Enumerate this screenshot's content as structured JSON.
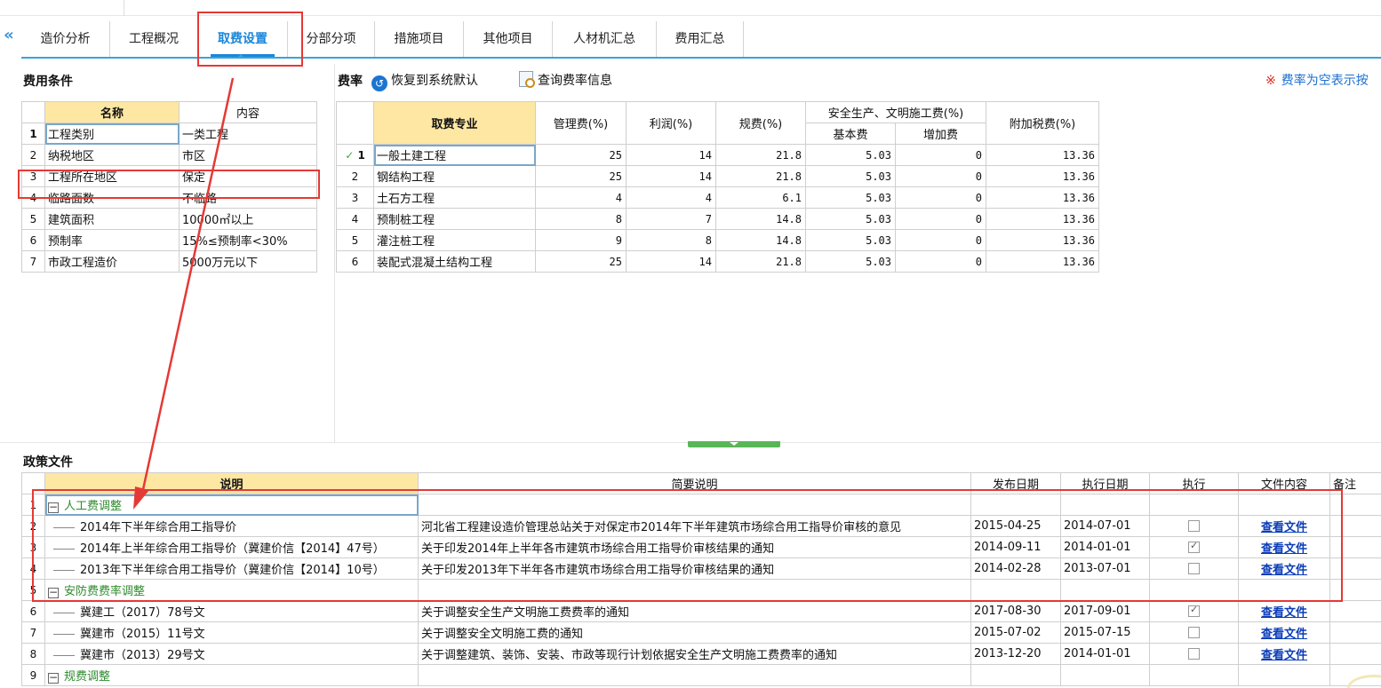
{
  "tabs": [
    {
      "label": "造价分析",
      "active": false
    },
    {
      "label": "工程概况",
      "active": false
    },
    {
      "label": "取费设置",
      "active": true
    },
    {
      "label": "分部分项",
      "active": false
    },
    {
      "label": "措施项目",
      "active": false
    },
    {
      "label": "其他项目",
      "active": false
    },
    {
      "label": "人材机汇总",
      "active": false
    },
    {
      "label": "费用汇总",
      "active": false
    }
  ],
  "conditions": {
    "title": "费用条件",
    "col_name": "名称",
    "col_content": "内容",
    "rows": [
      {
        "no": "1",
        "name": "工程类别",
        "value": "一类工程"
      },
      {
        "no": "2",
        "name": "纳税地区",
        "value": "市区"
      },
      {
        "no": "3",
        "name": "工程所在地区",
        "value": "保定"
      },
      {
        "no": "4",
        "name": "临路面数",
        "value": "不临路"
      },
      {
        "no": "5",
        "name": "建筑面积",
        "value": "10000㎡以上"
      },
      {
        "no": "6",
        "name": "预制率",
        "value": "15%≤预制率<30%"
      },
      {
        "no": "7",
        "name": "市政工程造价",
        "value": "5000万元以下"
      }
    ]
  },
  "rates": {
    "title": "费率",
    "restore_label": "恢复到系统默认",
    "query_label": "查询费率信息",
    "note_mark": "※",
    "note_text": "费率为空表示按",
    "headers": {
      "specialty": "取费专业",
      "mgmt": "管理费(%)",
      "profit": "利润(%)",
      "fee": "规费(%)",
      "safety_group": "安全生产、文明施工费(%)",
      "safety_base": "基本费",
      "safety_extra": "增加费",
      "tax": "附加税费(%)"
    },
    "check_mark": "✓",
    "rows": [
      {
        "no": "1",
        "name": "一般土建工程",
        "mgmt": "25",
        "profit": "14",
        "fee": "21.8",
        "base": "5.03",
        "extra": "0",
        "tax": "13.36"
      },
      {
        "no": "2",
        "name": "钢结构工程",
        "mgmt": "25",
        "profit": "14",
        "fee": "21.8",
        "base": "5.03",
        "extra": "0",
        "tax": "13.36"
      },
      {
        "no": "3",
        "name": "土石方工程",
        "mgmt": "4",
        "profit": "4",
        "fee": "6.1",
        "base": "5.03",
        "extra": "0",
        "tax": "13.36"
      },
      {
        "no": "4",
        "name": "预制桩工程",
        "mgmt": "8",
        "profit": "7",
        "fee": "14.8",
        "base": "5.03",
        "extra": "0",
        "tax": "13.36"
      },
      {
        "no": "5",
        "name": "灌注桩工程",
        "mgmt": "9",
        "profit": "8",
        "fee": "14.8",
        "base": "5.03",
        "extra": "0",
        "tax": "13.36"
      },
      {
        "no": "6",
        "name": "装配式混凝土结构工程",
        "mgmt": "25",
        "profit": "14",
        "fee": "21.8",
        "base": "5.03",
        "extra": "0",
        "tax": "13.36"
      }
    ]
  },
  "policy": {
    "title": "政策文件",
    "headers": {
      "desc": "说明",
      "summary": "简要说明",
      "pub": "发布日期",
      "exec": "执行日期",
      "run": "执行",
      "file": "文件内容",
      "remark": "备注"
    },
    "tree_toggle": "−",
    "link_label": "查看文件",
    "rows": [
      {
        "no": "1",
        "type": "group",
        "desc": "人工费调整"
      },
      {
        "no": "2",
        "type": "item",
        "desc": "2014年下半年综合用工指导价",
        "summary": "河北省工程建设造价管理总站关于对保定市2014年下半年建筑市场综合用工指导价审核的意见",
        "pub": "2015-04-25",
        "exec": "2014-07-01",
        "checked": false
      },
      {
        "no": "3",
        "type": "item",
        "desc": "2014年上半年综合用工指导价（冀建价信【2014】47号）",
        "summary": "关于印发2014年上半年各市建筑市场综合用工指导价审核结果的通知",
        "pub": "2014-09-11",
        "exec": "2014-01-01",
        "checked": true
      },
      {
        "no": "4",
        "type": "item",
        "desc": "2013年下半年综合用工指导价（冀建价信【2014】10号）",
        "summary": "关于印发2013年下半年各市建筑市场综合用工指导价审核结果的通知",
        "pub": "2014-02-28",
        "exec": "2013-07-01",
        "checked": false
      },
      {
        "no": "5",
        "type": "group",
        "desc": "安防费费率调整"
      },
      {
        "no": "6",
        "type": "item",
        "desc": "冀建工（2017）78号文",
        "summary": "关于调整安全生产文明施工费费率的通知",
        "pub": "2017-08-30",
        "exec": "2017-09-01",
        "checked": true
      },
      {
        "no": "7",
        "type": "item",
        "desc": "冀建市（2015）11号文",
        "summary": "关于调整安全文明施工费的通知",
        "pub": "2015-07-02",
        "exec": "2015-07-15",
        "checked": false
      },
      {
        "no": "8",
        "type": "item",
        "desc": "冀建市（2013）29号文",
        "summary": "关于调整建筑、装饰、安装、市政等现行计划依据安全生产文明施工费费率的通知",
        "pub": "2013-12-20",
        "exec": "2014-01-01",
        "checked": false
      },
      {
        "no": "9",
        "type": "group",
        "desc": "规费调整"
      }
    ]
  },
  "colors": {
    "accent": "#1a86d9",
    "header_gold": "#fde7a3",
    "group_green": "#2e8b2e",
    "annotation_red": "#e53935"
  }
}
